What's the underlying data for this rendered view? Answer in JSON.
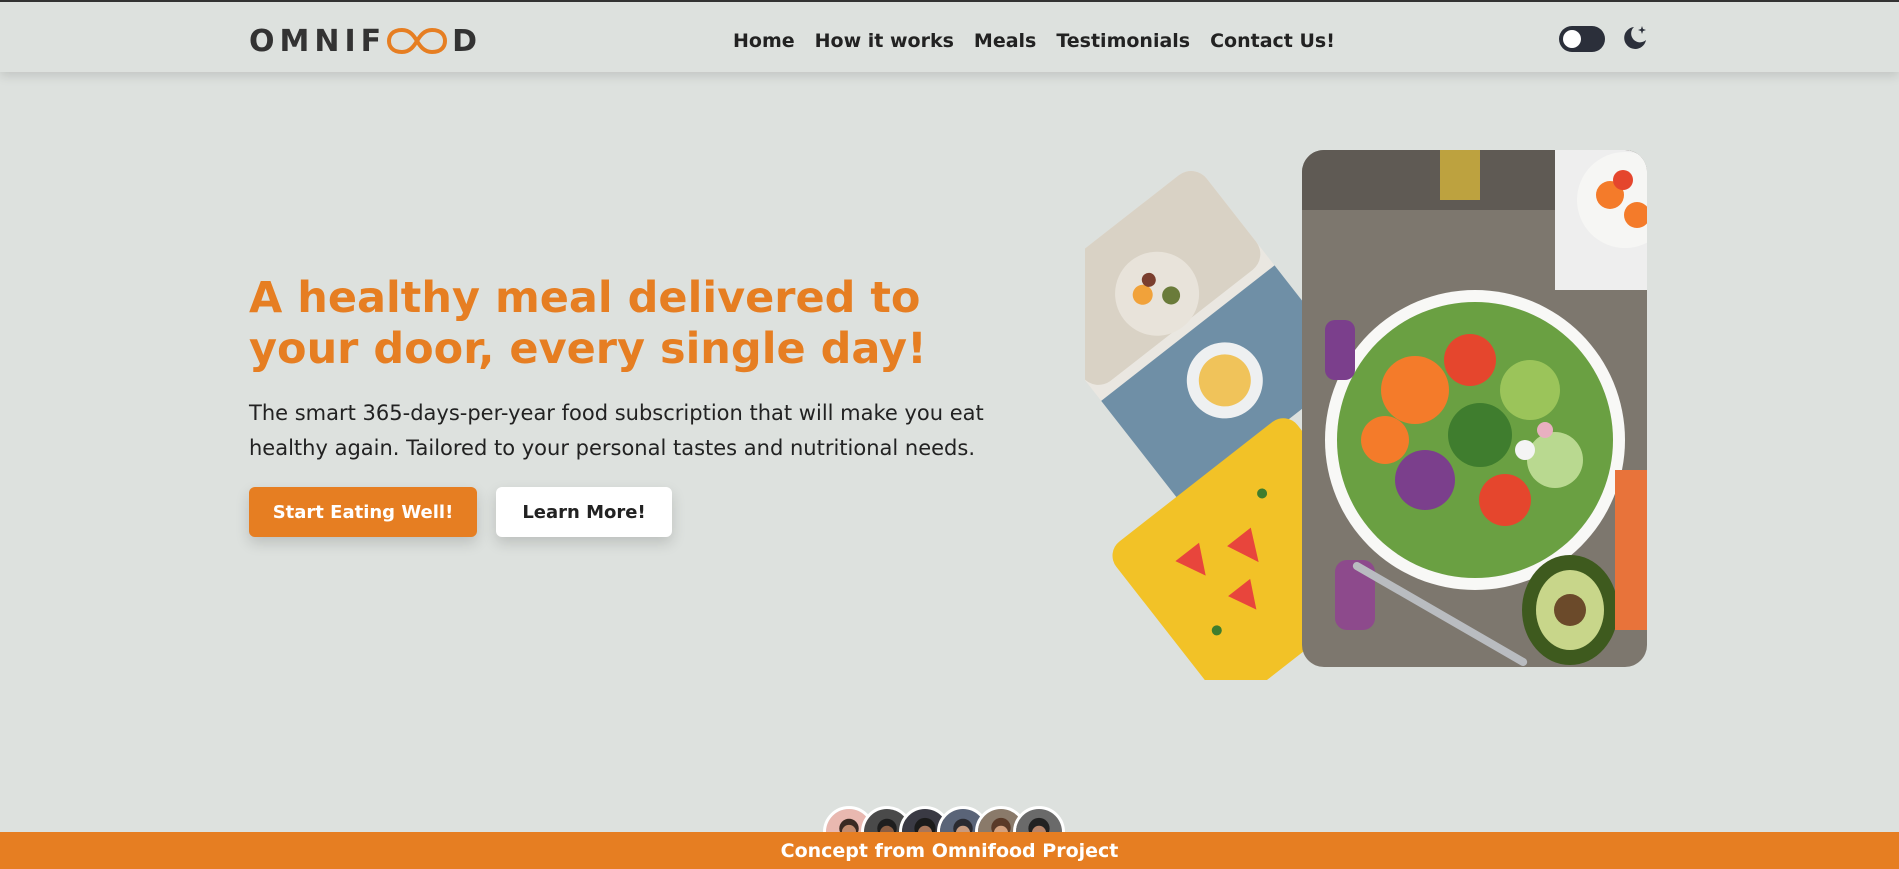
{
  "brand": {
    "logo_prefix": "OMNIF",
    "logo_suffix": "D",
    "accent": "#e67e22"
  },
  "nav": {
    "items": [
      {
        "label": "Home"
      },
      {
        "label": "How it works"
      },
      {
        "label": "Meals"
      },
      {
        "label": "Testimonials"
      },
      {
        "label": "Contact Us!"
      }
    ]
  },
  "header": {
    "theme_toggle_icon": "toggle-switch-icon",
    "dark_mode_icon": "moon-icon"
  },
  "hero": {
    "title": "A healthy meal delivered to your door, every single day!",
    "description": "The smart 365-days-per-year food subscription that will make you eat healthy again. Tailored to your personal tastes and nutritional needs.",
    "primary_button": "Start Eating Well!",
    "secondary_button": "Learn More!",
    "image": "salad-meal-illustration"
  },
  "customers": {
    "avatar_count": 6
  },
  "footer": {
    "text": "Concept from Omnifood Project"
  }
}
